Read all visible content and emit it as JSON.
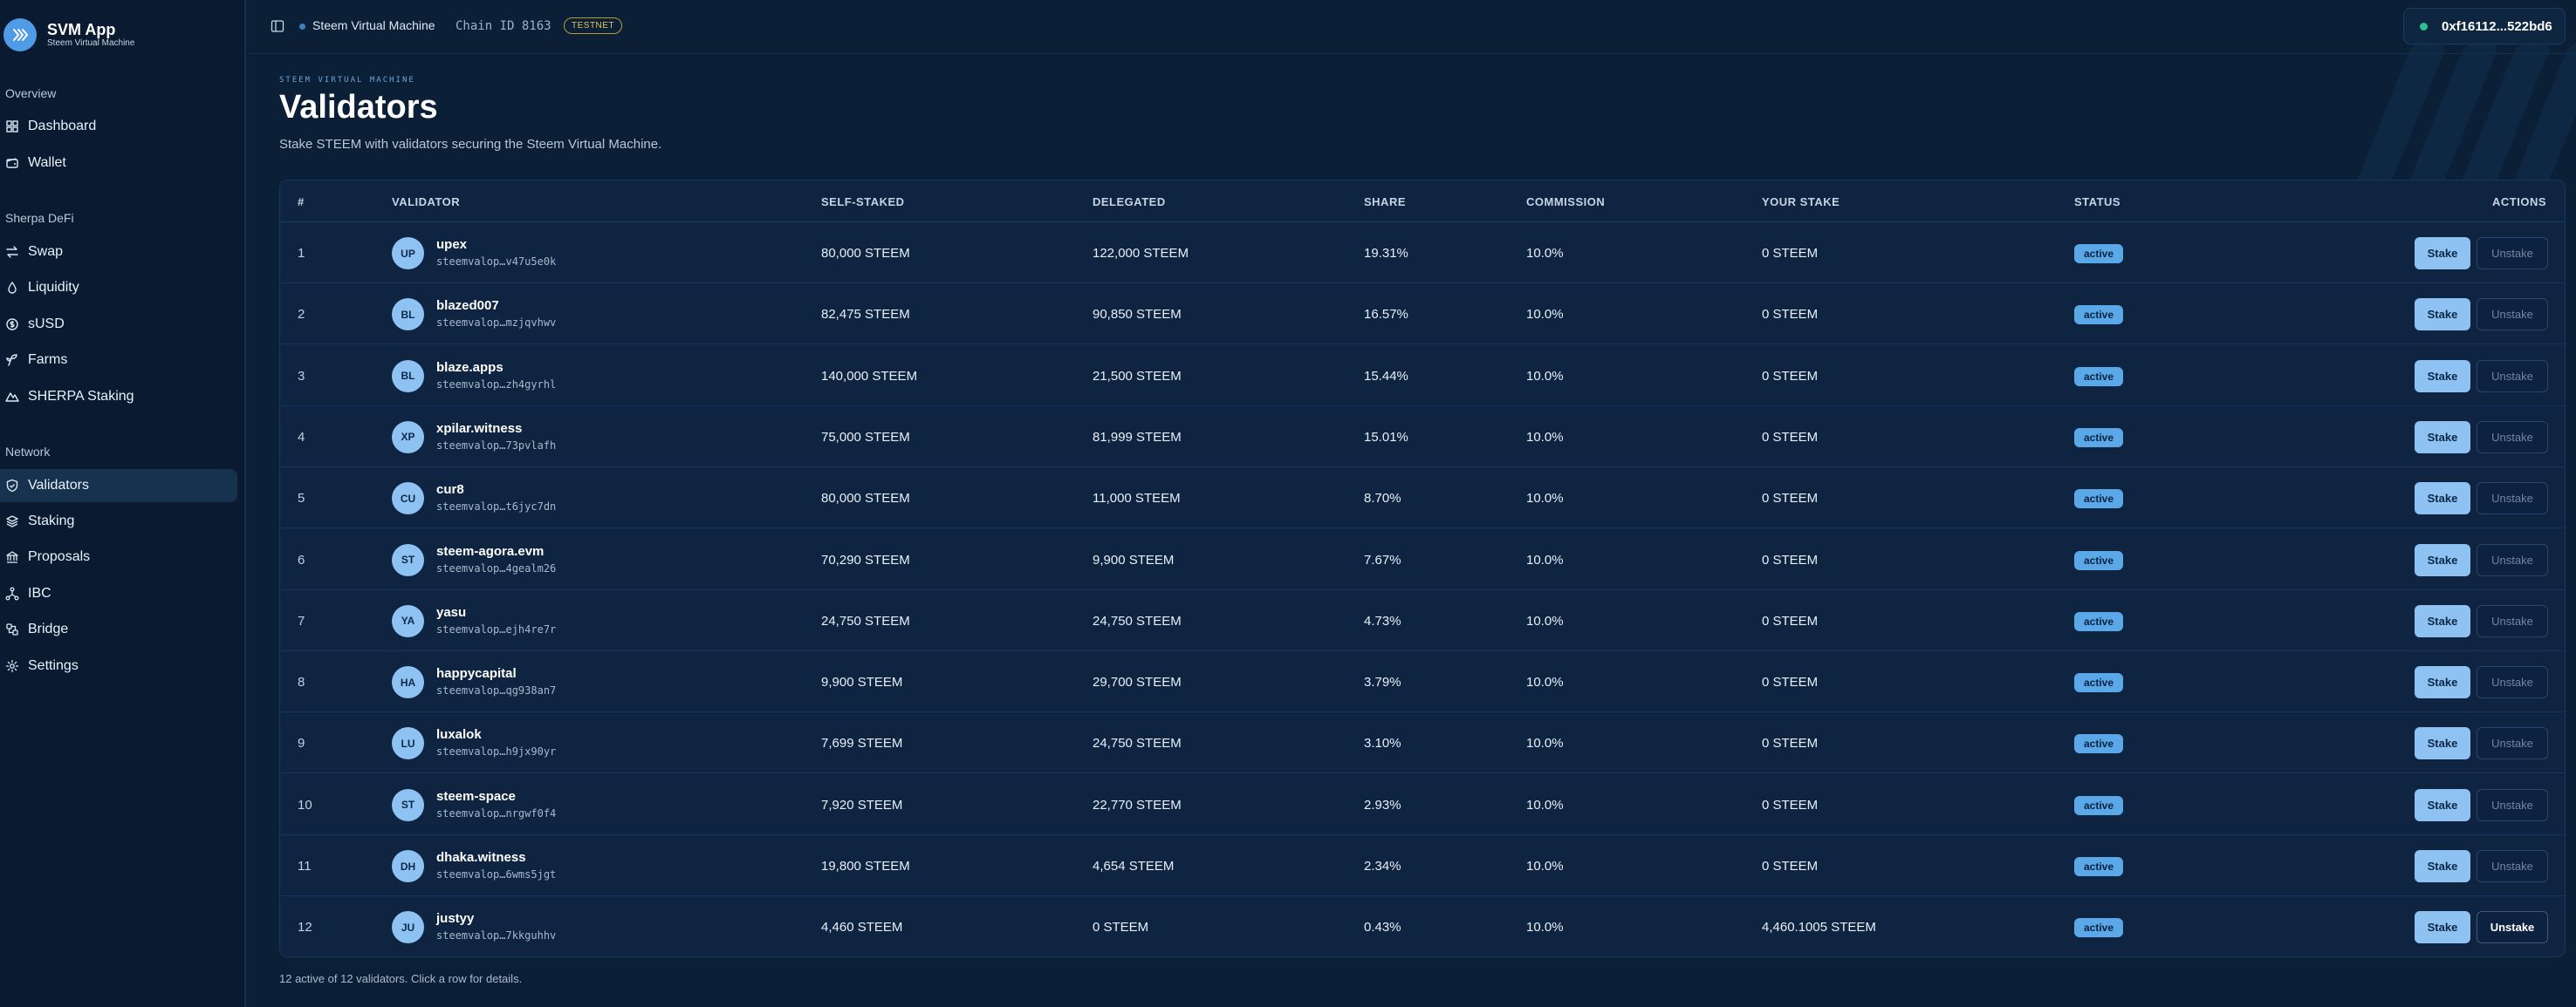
{
  "brand": {
    "name": "SVM App",
    "subtitle": "Steem Virtual Machine"
  },
  "sidebar": {
    "sections": [
      {
        "title": "Overview",
        "items": [
          {
            "label": "Dashboard",
            "icon": "grid-icon",
            "active": false
          },
          {
            "label": "Wallet",
            "icon": "wallet-icon",
            "active": false
          }
        ]
      },
      {
        "title": "Sherpa DeFi",
        "items": [
          {
            "label": "Swap",
            "icon": "swap-icon",
            "active": false
          },
          {
            "label": "Liquidity",
            "icon": "droplet-icon",
            "active": false
          },
          {
            "label": "sUSD",
            "icon": "dollar-icon",
            "active": false
          },
          {
            "label": "Farms",
            "icon": "sprout-icon",
            "active": false
          },
          {
            "label": "SHERPA Staking",
            "icon": "mountain-icon",
            "active": false
          }
        ]
      },
      {
        "title": "Network",
        "items": [
          {
            "label": "Validators",
            "icon": "shield-icon",
            "active": true
          },
          {
            "label": "Staking",
            "icon": "layers-icon",
            "active": false
          },
          {
            "label": "Proposals",
            "icon": "landmark-icon",
            "active": false
          },
          {
            "label": "IBC",
            "icon": "network-icon",
            "active": false
          },
          {
            "label": "Bridge",
            "icon": "bridge-icon",
            "active": false
          },
          {
            "label": "Settings",
            "icon": "gear-icon",
            "active": false
          }
        ]
      }
    ]
  },
  "topbar": {
    "chain_name": "Steem Virtual Machine",
    "chain_id": "Chain ID 8163",
    "network_badge": "TESTNET",
    "wallet_address": "0xf16112...522bd6"
  },
  "page": {
    "eyebrow": "STEEM VIRTUAL MACHINE",
    "title": "Validators",
    "subtitle": "Stake STEEM with validators securing the Steem Virtual Machine."
  },
  "table": {
    "columns": [
      "#",
      "VALIDATOR",
      "SELF-STAKED",
      "DELEGATED",
      "SHARE",
      "COMMISSION",
      "YOUR STAKE",
      "STATUS",
      "ACTIONS"
    ],
    "stake_label": "Stake",
    "unstake_label": "Unstake",
    "rows": [
      {
        "n": "1",
        "initials": "UP",
        "name": "upex",
        "address": "steemvalop…v47u5e0k",
        "self": "80,000 STEEM",
        "delegated": "122,000 STEEM",
        "share": "19.31%",
        "commission": "10.0%",
        "your": "0 STEEM",
        "status": "active",
        "can_unstake": false
      },
      {
        "n": "2",
        "initials": "BL",
        "name": "blazed007",
        "address": "steemvalop…mzjqvhwv",
        "self": "82,475 STEEM",
        "delegated": "90,850 STEEM",
        "share": "16.57%",
        "commission": "10.0%",
        "your": "0 STEEM",
        "status": "active",
        "can_unstake": false
      },
      {
        "n": "3",
        "initials": "BL",
        "name": "blaze.apps",
        "address": "steemvalop…zh4gyrhl",
        "self": "140,000 STEEM",
        "delegated": "21,500 STEEM",
        "share": "15.44%",
        "commission": "10.0%",
        "your": "0 STEEM",
        "status": "active",
        "can_unstake": false
      },
      {
        "n": "4",
        "initials": "XP",
        "name": "xpilar.witness",
        "address": "steemvalop…73pvlafh",
        "self": "75,000 STEEM",
        "delegated": "81,999 STEEM",
        "share": "15.01%",
        "commission": "10.0%",
        "your": "0 STEEM",
        "status": "active",
        "can_unstake": false
      },
      {
        "n": "5",
        "initials": "CU",
        "name": "cur8",
        "address": "steemvalop…t6jyc7dn",
        "self": "80,000 STEEM",
        "delegated": "11,000 STEEM",
        "share": "8.70%",
        "commission": "10.0%",
        "your": "0 STEEM",
        "status": "active",
        "can_unstake": false
      },
      {
        "n": "6",
        "initials": "ST",
        "name": "steem-agora.evm",
        "address": "steemvalop…4gealm26",
        "self": "70,290 STEEM",
        "delegated": "9,900 STEEM",
        "share": "7.67%",
        "commission": "10.0%",
        "your": "0 STEEM",
        "status": "active",
        "can_unstake": false
      },
      {
        "n": "7",
        "initials": "YA",
        "name": "yasu",
        "address": "steemvalop…ejh4re7r",
        "self": "24,750 STEEM",
        "delegated": "24,750 STEEM",
        "share": "4.73%",
        "commission": "10.0%",
        "your": "0 STEEM",
        "status": "active",
        "can_unstake": false
      },
      {
        "n": "8",
        "initials": "HA",
        "name": "happycapital",
        "address": "steemvalop…qg938an7",
        "self": "9,900 STEEM",
        "delegated": "29,700 STEEM",
        "share": "3.79%",
        "commission": "10.0%",
        "your": "0 STEEM",
        "status": "active",
        "can_unstake": false
      },
      {
        "n": "9",
        "initials": "LU",
        "name": "luxalok",
        "address": "steemvalop…h9jx90yr",
        "self": "7,699 STEEM",
        "delegated": "24,750 STEEM",
        "share": "3.10%",
        "commission": "10.0%",
        "your": "0 STEEM",
        "status": "active",
        "can_unstake": false
      },
      {
        "n": "10",
        "initials": "ST",
        "name": "steem-space",
        "address": "steemvalop…nrgwf0f4",
        "self": "7,920 STEEM",
        "delegated": "22,770 STEEM",
        "share": "2.93%",
        "commission": "10.0%",
        "your": "0 STEEM",
        "status": "active",
        "can_unstake": false
      },
      {
        "n": "11",
        "initials": "DH",
        "name": "dhaka.witness",
        "address": "steemvalop…6wms5jgt",
        "self": "19,800 STEEM",
        "delegated": "4,654 STEEM",
        "share": "2.34%",
        "commission": "10.0%",
        "your": "0 STEEM",
        "status": "active",
        "can_unstake": false
      },
      {
        "n": "12",
        "initials": "JU",
        "name": "justyy",
        "address": "steemvalop…7kkguhhv",
        "self": "4,460 STEEM",
        "delegated": "0 STEEM",
        "share": "0.43%",
        "commission": "10.0%",
        "your": "4,460.1005 STEEM",
        "status": "active",
        "can_unstake": true
      }
    ]
  },
  "footer": {
    "note": "12 active of 12 validators. Click a row for details."
  }
}
